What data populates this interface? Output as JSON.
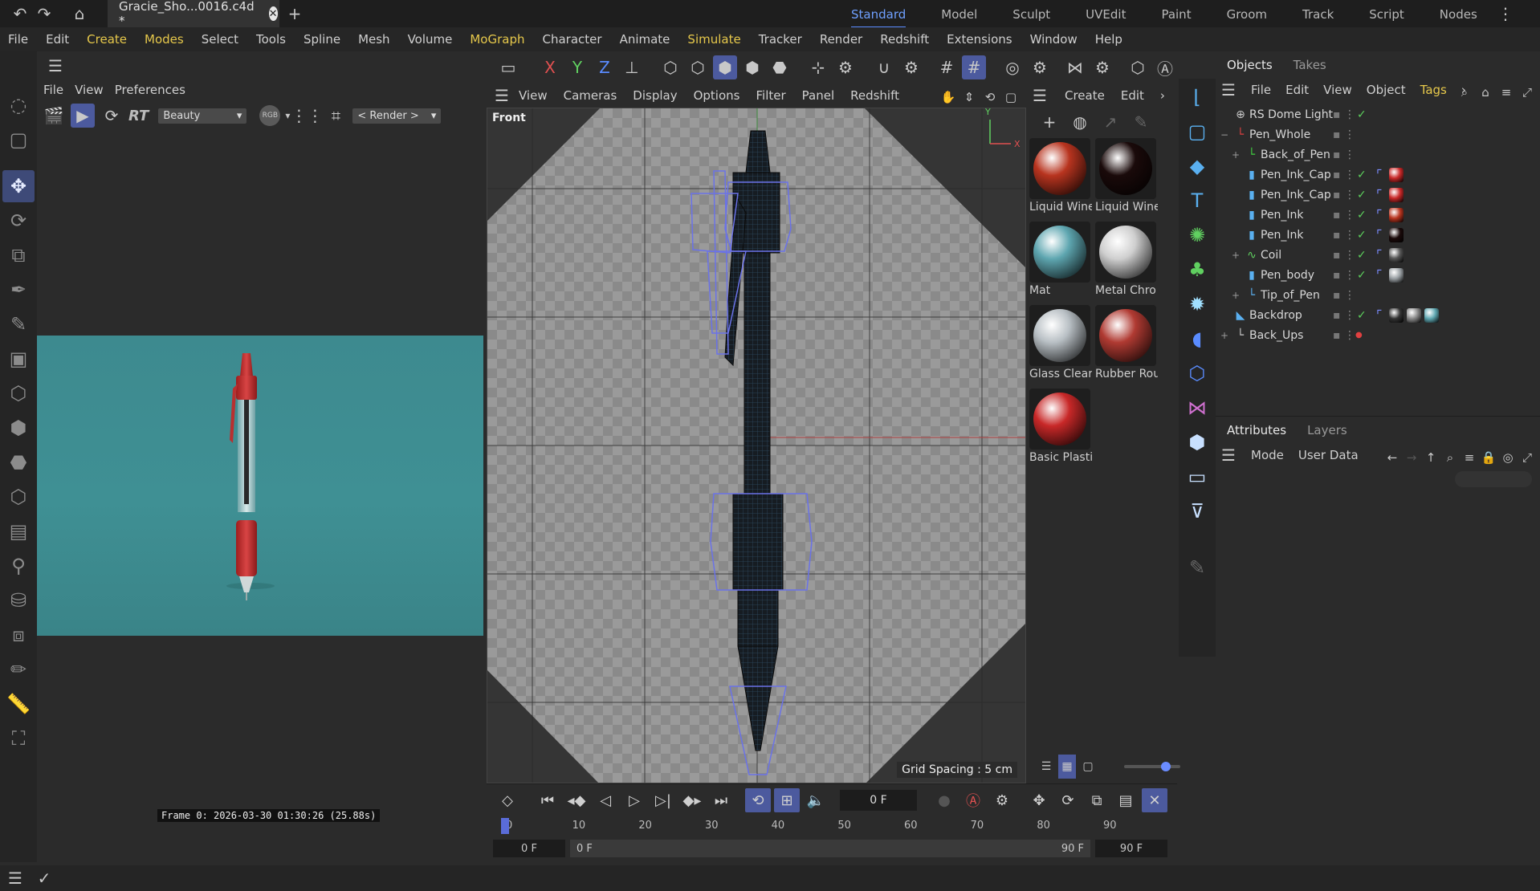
{
  "titlebar": {
    "doc_tab": "Gracie_Sho...0016.c4d *",
    "layouts": [
      "Standard",
      "Model",
      "Sculpt",
      "UVEdit",
      "Paint",
      "Groom",
      "Track",
      "Script",
      "Nodes"
    ],
    "active_layout": "Standard"
  },
  "menubar": {
    "items": [
      "File",
      "Edit",
      "Create",
      "Modes",
      "Select",
      "Tools",
      "Spline",
      "Mesh",
      "Volume",
      "MoGraph",
      "Character",
      "Animate",
      "Simulate",
      "Tracker",
      "Render",
      "Redshift",
      "Extensions",
      "Window",
      "Help"
    ],
    "highlighted": [
      "Create",
      "Modes",
      "MoGraph",
      "Simulate"
    ]
  },
  "render_view": {
    "menu": [
      "File",
      "View",
      "Preferences"
    ],
    "aov": "Beauty",
    "rgb_label": "RGB",
    "render_label": "< Render >",
    "rt_label": "RT",
    "frame_info": "Frame  0: 2026-03-30 01:30:26 (25.88s)",
    "bg_color": "#3f8a8e"
  },
  "viewport": {
    "menu": [
      "View",
      "Cameras",
      "Display",
      "Options",
      "Filter",
      "Panel",
      "Redshift"
    ],
    "label": "Front",
    "grid_spacing": "Grid Spacing : 5 cm",
    "axis_y": "Y",
    "axis_x": "X"
  },
  "materials": {
    "menu": [
      "Create",
      "Edit"
    ],
    "items": [
      {
        "name": "Liquid Wine",
        "color": "#b8341f"
      },
      {
        "name": "Liquid Wine",
        "color": "#1a0a0a"
      },
      {
        "name": "Mat",
        "color": "#5ea6b0"
      },
      {
        "name": "Metal Chro",
        "color": "#cfcfcf"
      },
      {
        "name": "Glass Clear",
        "color": "#b8bfc4"
      },
      {
        "name": "Rubber Rou",
        "color": "#b03a32"
      },
      {
        "name": "Basic Plastic",
        "color": "#c82828"
      }
    ]
  },
  "objects": {
    "tabs": [
      "Objects",
      "Takes"
    ],
    "menu": [
      "File",
      "Edit",
      "View",
      "Object",
      "Tags"
    ],
    "items": [
      {
        "name": "RS Dome Light",
        "indent": 0,
        "expand": "",
        "icon": "globe-icon",
        "icolor": "#c8c8c8",
        "check": true,
        "tags": []
      },
      {
        "name": "Pen_Whole",
        "indent": 0,
        "expand": "−",
        "icon": "null-icon",
        "icolor": "#e04040",
        "check": false,
        "tags": []
      },
      {
        "name": "Back_of_Pen",
        "indent": 1,
        "expand": "+",
        "icon": "null-icon",
        "icolor": "#40d040",
        "check": false,
        "tags": []
      },
      {
        "name": "Pen_Ink_Cap",
        "indent": 1,
        "expand": "",
        "icon": "cylinder-icon",
        "icolor": "#5ab0f0",
        "check": true,
        "tags": [
          "#c82828"
        ]
      },
      {
        "name": "Pen_Ink_Cap",
        "indent": 1,
        "expand": "",
        "icon": "cylinder-icon",
        "icolor": "#5ab0f0",
        "check": true,
        "tags": [
          "#c82828"
        ]
      },
      {
        "name": "Pen_Ink",
        "indent": 1,
        "expand": "",
        "icon": "cylinder-icon",
        "icolor": "#5ab0f0",
        "check": true,
        "tags": [
          "#b8341f"
        ]
      },
      {
        "name": "Pen_Ink",
        "indent": 1,
        "expand": "",
        "icon": "cylinder-icon",
        "icolor": "#5ab0f0",
        "check": true,
        "tags": [
          "#1a0a0a"
        ]
      },
      {
        "name": "Coil",
        "indent": 1,
        "expand": "+",
        "icon": "spline-icon",
        "icolor": "#60d060",
        "check": true,
        "tags": [
          "#555"
        ]
      },
      {
        "name": "Pen_body",
        "indent": 1,
        "expand": "",
        "icon": "cylinder-icon",
        "icolor": "#5ab0f0",
        "check": true,
        "tags": [
          "#9aa0a4"
        ]
      },
      {
        "name": "Tip_of_Pen",
        "indent": 1,
        "expand": "+",
        "icon": "null-icon",
        "icolor": "#5ab0f0",
        "check": false,
        "tags": []
      },
      {
        "name": "Backdrop",
        "indent": 0,
        "expand": "",
        "icon": "backdrop-icon",
        "icolor": "#5ab0f0",
        "check": true,
        "tags": [
          "#333",
          "#888",
          "#5ea6b0"
        ]
      },
      {
        "name": "Back_Ups",
        "indent": 0,
        "expand": "+",
        "icon": "null-icon",
        "icolor": "#c8c8c8",
        "check": false,
        "tags": []
      }
    ]
  },
  "attributes": {
    "tabs": [
      "Attributes",
      "Layers"
    ],
    "menu": [
      "Mode",
      "User Data"
    ]
  },
  "timeline": {
    "current_frame": "0 F",
    "ticks": [
      "0",
      "10",
      "20",
      "30",
      "40",
      "50",
      "60",
      "70",
      "80",
      "90"
    ],
    "start": "0 F",
    "range_start": "0 F",
    "range_end": "90 F",
    "end": "90 F"
  }
}
